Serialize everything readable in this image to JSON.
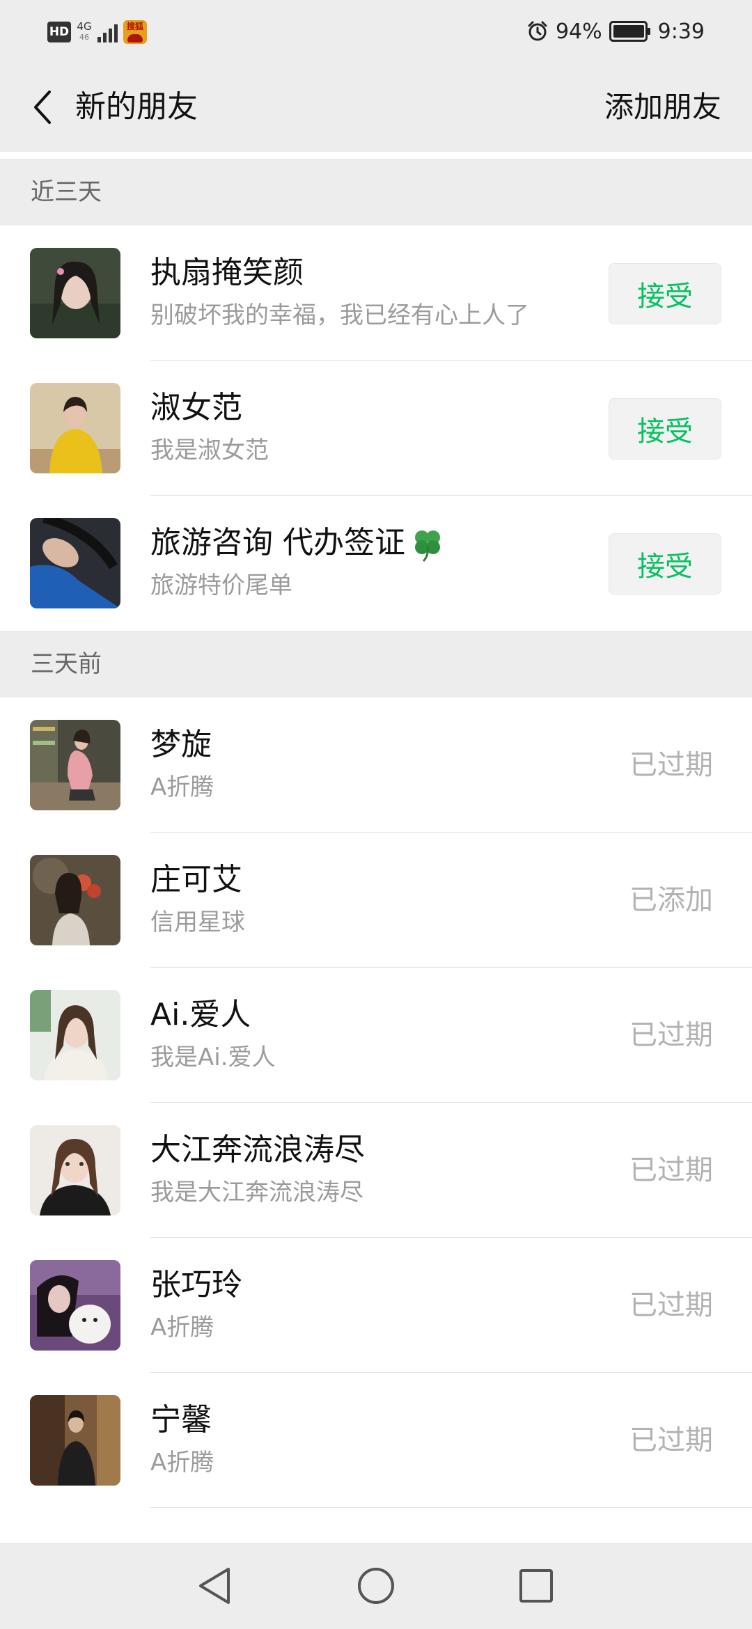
{
  "status_bar": {
    "hd": "HD",
    "network": "4G",
    "network_sub": "46",
    "app_notification": "搜狐",
    "battery": "94%",
    "time": "9:39"
  },
  "header": {
    "title": "新的朋友",
    "add_friend": "添加朋友"
  },
  "sections": [
    {
      "title": "近三天",
      "items": [
        {
          "name": "执扇掩笑颜",
          "message": "别破坏我的幸福，我已经有心上人了",
          "action": "接受"
        },
        {
          "name": "淑女范",
          "message": "我是淑女范",
          "action": "接受"
        },
        {
          "name": "旅游咨询  代办签证",
          "name_icon": "four-leaf-clover-icon",
          "message": "旅游特价尾单",
          "action": "接受"
        }
      ]
    },
    {
      "title": "三天前",
      "items": [
        {
          "name": "梦旋",
          "message": "A折腾",
          "status": "已过期"
        },
        {
          "name": "庄可艾",
          "message": "信用星球",
          "status": "已添加"
        },
        {
          "name": "Ai.爱人",
          "message": "我是Ai.爱人",
          "status": "已过期"
        },
        {
          "name": "大江奔流浪涛尽",
          "message": "我是大江奔流浪涛尽",
          "status": "已过期"
        },
        {
          "name": "张巧玲",
          "message": "A折腾",
          "status": "已过期"
        },
        {
          "name": "宁馨",
          "message": "A折腾",
          "status": "已过期"
        }
      ]
    }
  ],
  "colors": {
    "accent_green": "#07c160",
    "background_gray": "#ededed",
    "muted_text": "#9b9b9b"
  },
  "nav_bar": {
    "icons": [
      "back-triangle-icon",
      "home-circle-icon",
      "recents-square-icon"
    ]
  }
}
